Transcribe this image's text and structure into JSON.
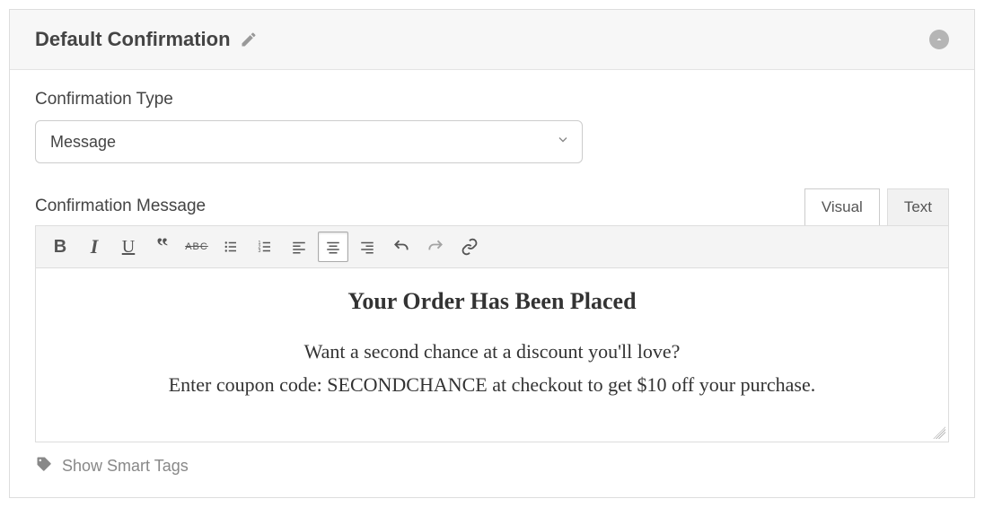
{
  "panel": {
    "title": "Default Confirmation"
  },
  "fields": {
    "type_label": "Confirmation Type",
    "type_value": "Message",
    "message_label": "Confirmation Message"
  },
  "tabs": {
    "visual": "Visual",
    "text": "Text",
    "active": "visual"
  },
  "toolbar": {
    "buttons": [
      {
        "name": "bold"
      },
      {
        "name": "italic"
      },
      {
        "name": "underline"
      },
      {
        "name": "quote"
      },
      {
        "name": "strike"
      },
      {
        "name": "ul"
      },
      {
        "name": "ol"
      },
      {
        "name": "align-left"
      },
      {
        "name": "align-center",
        "active": true
      },
      {
        "name": "align-right"
      },
      {
        "name": "undo"
      },
      {
        "name": "redo"
      },
      {
        "name": "link"
      }
    ]
  },
  "editor": {
    "heading": "Your Order Has Been Placed",
    "line1": "Want a second chance at a discount you'll love?",
    "line2": "Enter coupon code: SECONDCHANCE at checkout to get $10 off your purchase."
  },
  "footer": {
    "smart_tags": "Show Smart Tags"
  }
}
